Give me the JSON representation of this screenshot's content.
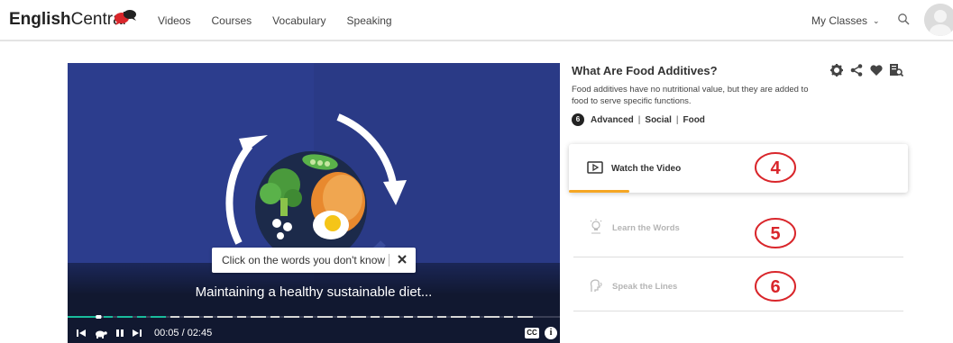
{
  "header": {
    "logo_bold": "English",
    "logo_regular": "Central",
    "nav": [
      "Videos",
      "Courses",
      "Vocabulary",
      "Speaking"
    ],
    "my_classes": "My Classes"
  },
  "video": {
    "tooltip_text": "Click on the words you don't know",
    "caption": "Maintaining a healthy sustainable diet...",
    "timecode": "00:05 / 02:45",
    "cc_label": "CC",
    "info_label": "i",
    "progress": 0.03
  },
  "lesson": {
    "title": "What Are Food Additives?",
    "description": "Food additives have no nutritional value, but they are added to food to serve specific functions.",
    "level_number": "6",
    "level": "Advanced",
    "category": "Social",
    "topic": "Food",
    "separator": "|"
  },
  "steps": [
    {
      "label": "Watch the Video",
      "active": true,
      "number": "4"
    },
    {
      "label": "Learn the Words",
      "active": false,
      "number": "5"
    },
    {
      "label": "Speak the Lines",
      "active": false,
      "number": "6"
    }
  ],
  "colors": {
    "accent_orange": "#f5a623",
    "annotation_red": "#d9262b",
    "video_bg": "#2b3d8f"
  }
}
